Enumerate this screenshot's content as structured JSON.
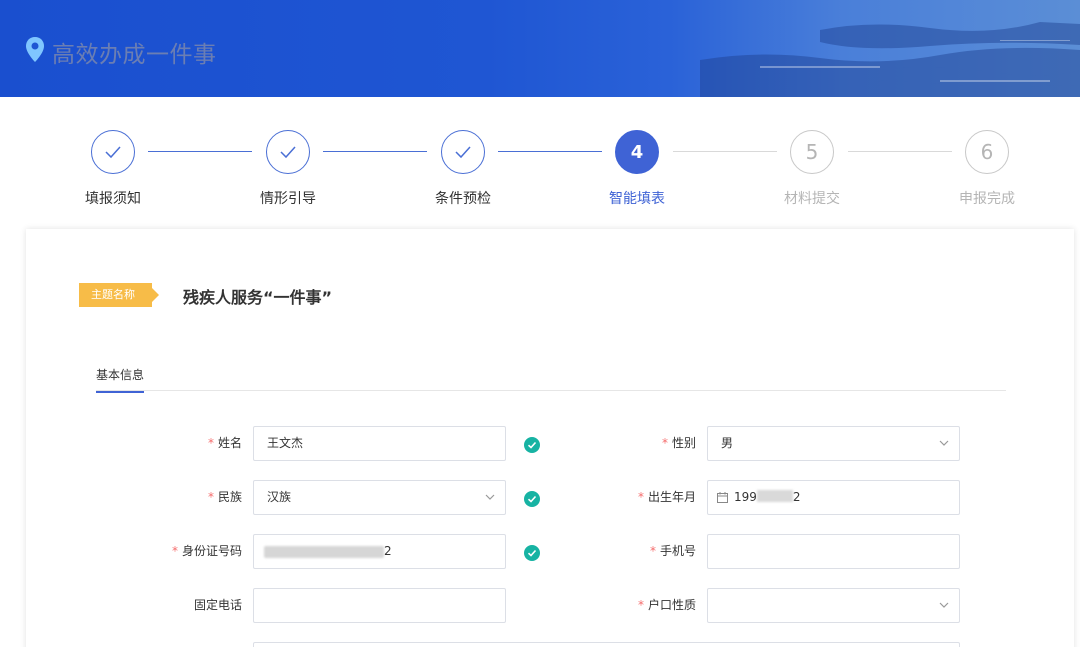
{
  "header": {
    "title": "高效办成一件事",
    "icon": "location-pin-icon"
  },
  "steps": [
    {
      "label": "填报须知",
      "number": "1",
      "state": "done"
    },
    {
      "label": "情形引导",
      "number": "2",
      "state": "done"
    },
    {
      "label": "条件预检",
      "number": "3",
      "state": "done"
    },
    {
      "label": "智能填表",
      "number": "4",
      "state": "active"
    },
    {
      "label": "材料提交",
      "number": "5",
      "state": "pending"
    },
    {
      "label": "申报完成",
      "number": "6",
      "state": "pending"
    }
  ],
  "topic": {
    "tag": "主题名称",
    "title": "残疾人服务“一件事”"
  },
  "tabs": [
    {
      "label": "基本信息",
      "active": true
    }
  ],
  "form": {
    "required_mark": "*",
    "name": {
      "label": "姓名",
      "value": "王文杰",
      "valid": true
    },
    "gender": {
      "label": "性别",
      "value": "男"
    },
    "ethnicity": {
      "label": "民族",
      "value": "汉族",
      "valid": true
    },
    "birth": {
      "label": "出生年月",
      "value_start": "199",
      "value_end": "2"
    },
    "id_number": {
      "label": "身份证号码",
      "value_end": "2",
      "valid": true
    },
    "phone": {
      "label": "手机号",
      "value": ""
    },
    "landline": {
      "label": "固定电话",
      "value": ""
    },
    "household": {
      "label": "户口性质",
      "value": ""
    }
  },
  "colors": {
    "primary": "#3f63d5",
    "tag": "#f7bc48",
    "valid": "#17b3a3",
    "required": "#f56c6c"
  }
}
